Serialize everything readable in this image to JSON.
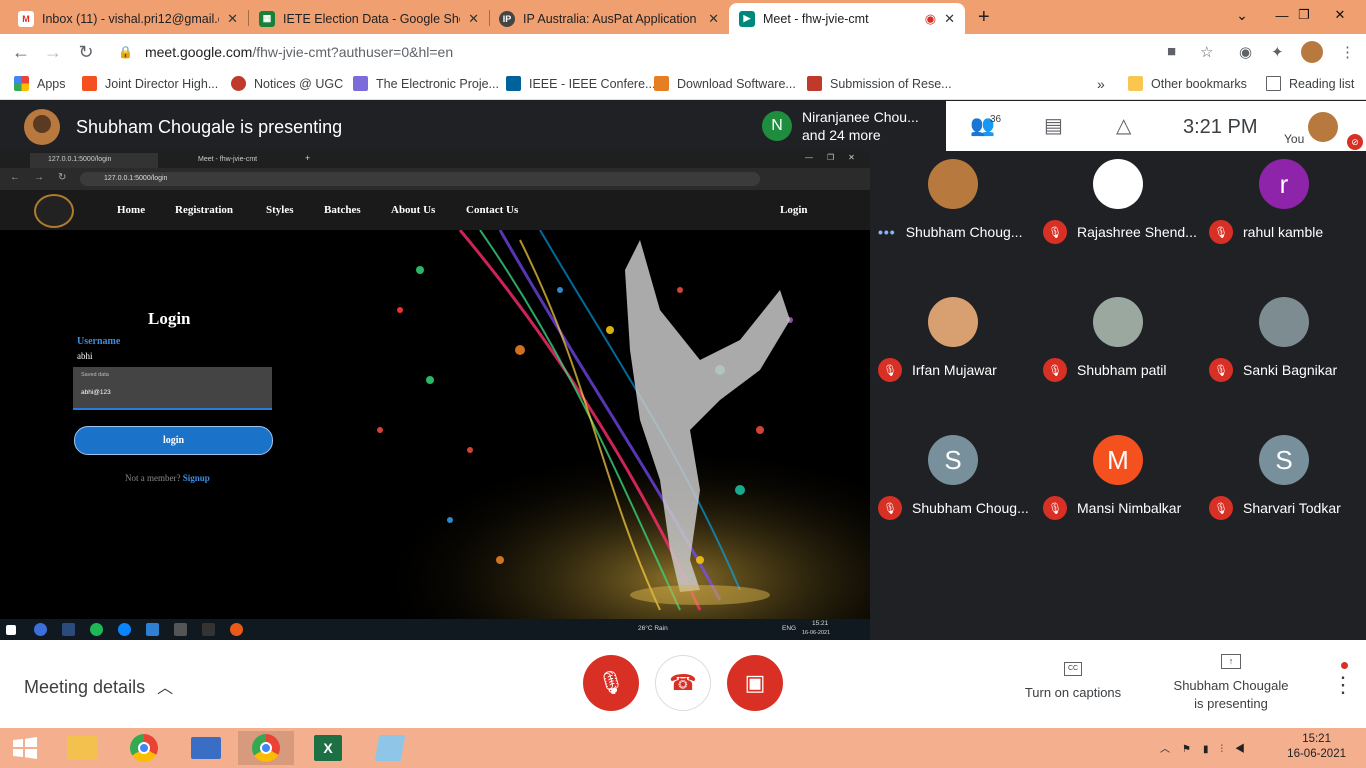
{
  "browser": {
    "tabs": [
      {
        "title": "Inbox (11) - vishal.pri12@gmail.c",
        "icon": "gmail-icon",
        "color": "#d93025"
      },
      {
        "title": "IETE Election Data - Google Shee",
        "icon": "sheets-icon",
        "color": "#188038"
      },
      {
        "title": "IP Australia: AusPat Application D",
        "icon": "ipa-icon",
        "color": "#555555"
      },
      {
        "title": "Meet - fhw-jvie-cmt",
        "icon": "meet-icon",
        "color": "#00897b",
        "active": true
      }
    ],
    "url_host": "meet.google.com",
    "url_path": "/fhw-jvie-cmt?authuser=0&hl=en",
    "bookmarks": [
      {
        "label": "Apps",
        "color": "#ea4335"
      },
      {
        "label": "Joint Director High...",
        "color": "#f4511e"
      },
      {
        "label": "Notices @ UGC",
        "color": "#c0392b"
      },
      {
        "label": "The Electronic Proje...",
        "color": "#7b6cd9"
      },
      {
        "label": "IEEE - IEEE Confere...",
        "color": "#00629b"
      },
      {
        "label": "Download Software...",
        "color": "#e67e22"
      },
      {
        "label": "Submission of Rese...",
        "color": "#c0392b"
      }
    ],
    "other_bookmarks": "Other bookmarks",
    "reading_list": "Reading list"
  },
  "meet": {
    "presenting_banner": "Shubham Chougale is presenting",
    "notify_initial": "N",
    "notify_line1": "Niranjanee Chou...",
    "notify_line2": "and 24 more",
    "participant_count": "36",
    "time": "3:21 PM",
    "you_label": "You",
    "participants": [
      {
        "name": "Shubham Choug...",
        "initial": "",
        "bg": "#b8793f",
        "muted": false
      },
      {
        "name": "Rajashree Shend...",
        "initial": "",
        "bg": "#ffffff",
        "muted": true
      },
      {
        "name": "rahul kamble",
        "initial": "r",
        "bg": "#8e24aa",
        "muted": true
      },
      {
        "name": "Irfan Mujawar",
        "initial": "",
        "bg": "#d8a070",
        "muted": true
      },
      {
        "name": "Shubham patil",
        "initial": "",
        "bg": "#9aa8a0",
        "muted": true
      },
      {
        "name": "Sanki Bagnikar",
        "initial": "",
        "bg": "#7c8c90",
        "muted": true
      },
      {
        "name": "Shubham Choug...",
        "initial": "S",
        "bg": "#78909c",
        "muted": true
      },
      {
        "name": "Mansi Nimbalkar",
        "initial": "M",
        "bg": "#f4511e",
        "muted": true
      },
      {
        "name": "Sharvari Todkar",
        "initial": "S",
        "bg": "#78909c",
        "muted": true
      }
    ],
    "meeting_details": "Meeting details",
    "captions": "Turn on captions",
    "presenting_ctl_1": "Shubham Chougale",
    "presenting_ctl_2": "is presenting"
  },
  "shared": {
    "tab1": "127.0.0.1:5000/login",
    "tab2": "Meet - fhw-jvie-cmt",
    "url": "127.0.0.1:5000/login",
    "nav": [
      "Home",
      "Registration",
      "Styles",
      "Batches",
      "About Us",
      "Contact Us"
    ],
    "nav_login": "Login",
    "login_title": "Login",
    "username_label": "Username",
    "username_value": "abhi",
    "saved_header": "Saved data",
    "saved_value": "abhi@123",
    "login_button": "login",
    "not_member": "Not a member?",
    "signup": "Signup",
    "weather": "26°C  Rain",
    "lang": "ENG",
    "task_time": "15:21",
    "task_date": "16-06-2021"
  },
  "windows": {
    "time": "15:21",
    "date": "16-06-2021"
  }
}
